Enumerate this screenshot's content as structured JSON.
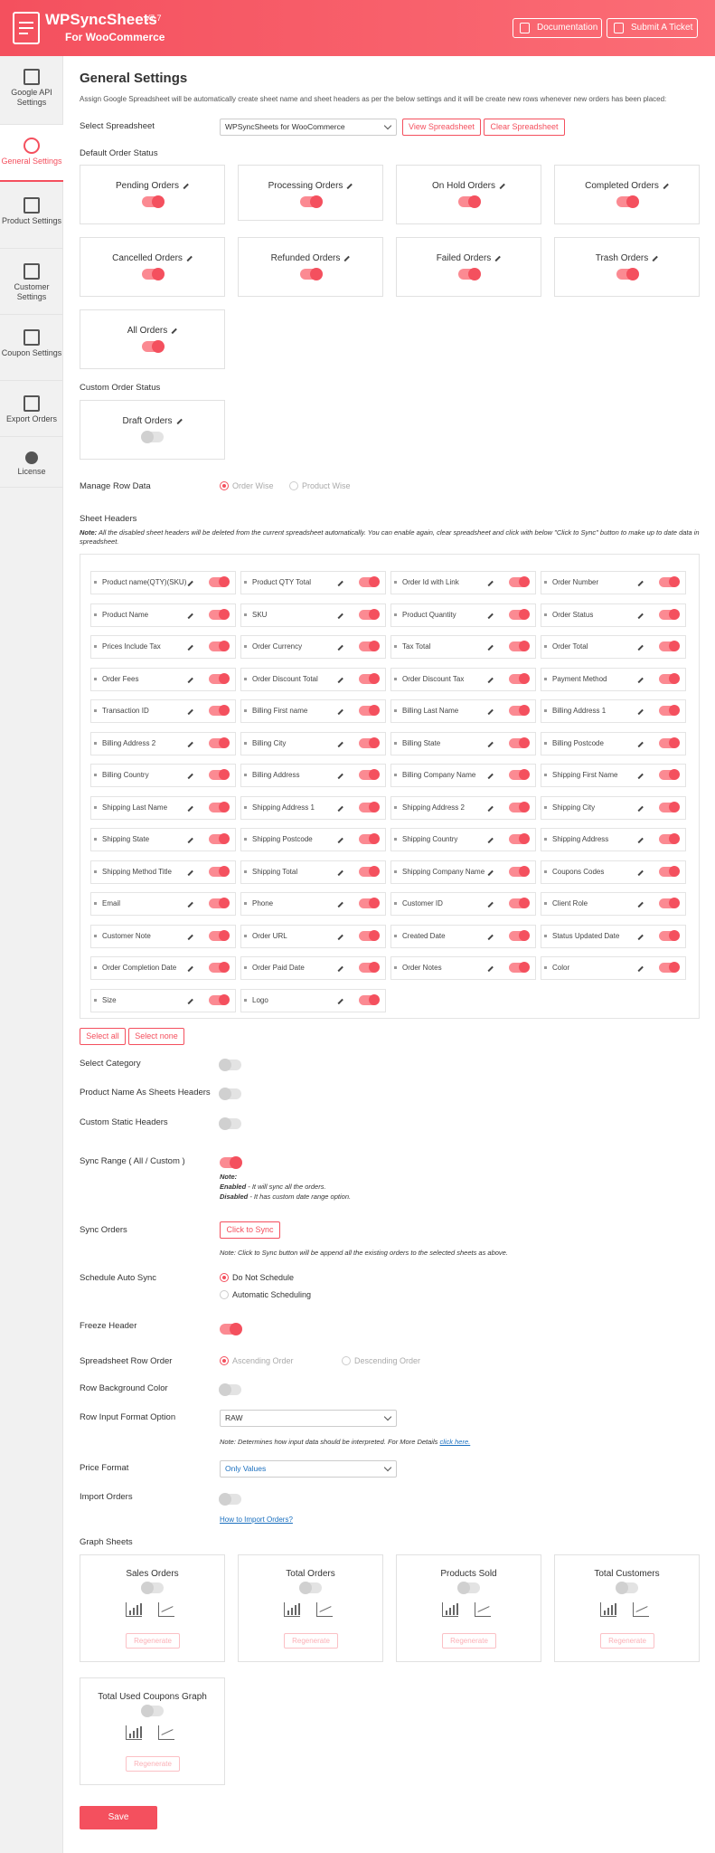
{
  "header": {
    "brand": "WPSyncSheets",
    "brand_sub": "For WooCommerce",
    "version": "V7.7",
    "documentation": "Documentation",
    "submit_ticket": "Submit A Ticket"
  },
  "sidebar": [
    {
      "label": "Google API Settings"
    },
    {
      "label": "General Settings"
    },
    {
      "label": "Product Settings"
    },
    {
      "label": "Customer Settings"
    },
    {
      "label": "Coupon Settings"
    },
    {
      "label": "Export Orders"
    },
    {
      "label": "License"
    }
  ],
  "page": {
    "title": "General Settings",
    "description": "Assign Google Spreadsheet will be automatically create sheet name and sheet headers as per the below settings and it will be create new rows whenever new orders has been placed:"
  },
  "spreadsheet": {
    "label": "Select Spreadsheet",
    "value": "WPSyncSheets for WooCommerce",
    "view": "View Spreadsheet",
    "clear": "Clear Spreadsheet"
  },
  "default_status": {
    "label": "Default Order Status",
    "items": [
      {
        "name": "Pending Orders",
        "on": true
      },
      {
        "name": "Processing Orders",
        "on": true
      },
      {
        "name": "On Hold Orders",
        "on": true
      },
      {
        "name": "Completed Orders",
        "on": true
      },
      {
        "name": "Cancelled Orders",
        "on": true
      },
      {
        "name": "Refunded Orders",
        "on": true
      },
      {
        "name": "Failed Orders",
        "on": true
      },
      {
        "name": "Trash Orders",
        "on": true
      },
      {
        "name": "All Orders",
        "on": true
      }
    ]
  },
  "custom_status": {
    "label": "Custom Order Status",
    "items": [
      {
        "name": "Draft Orders",
        "on": false
      }
    ]
  },
  "manage_row": {
    "label": "Manage Row Data",
    "opt1": "Order Wise",
    "opt2": "Product Wise"
  },
  "sheet_headers": {
    "label": "Sheet Headers",
    "note_b": "Note:",
    "note": " All the disabled sheet headers will be deleted from the current spreadsheet automatically. You can enable again, clear spreadsheet and click with below \"Click to Sync\" button to make up to date data in spreadsheet.",
    "items": [
      "Product name(QTY)(SKU)",
      "Product QTY Total",
      "Order Id with Link",
      "Order Number",
      "Product Name",
      "SKU",
      "Product Quantity",
      "Order Status",
      "Prices Include Tax",
      "Order Currency",
      "Tax Total",
      "Order Total",
      "Order Fees",
      "Order Discount Total",
      "Order Discount Tax",
      "Payment Method",
      "Transaction ID",
      "Billing First name",
      "Billing Last Name",
      "Billing Address 1",
      "Billing Address 2",
      "Billing City",
      "Billing State",
      "Billing Postcode",
      "Billing Country",
      "Billing Address",
      "Billing Company Name",
      "Shipping First Name",
      "Shipping Last Name",
      "Shipping Address 1",
      "Shipping Address 2",
      "Shipping City",
      "Shipping State",
      "Shipping Postcode",
      "Shipping Country",
      "Shipping Address",
      "Shipping Method Title",
      "Shipping Total",
      "Shipping Company Name",
      "Coupons Codes",
      "Email",
      "Phone",
      "Customer ID",
      "Client Role",
      "Customer Note",
      "Order URL",
      "Created Date",
      "Status Updated Date",
      "Order Completion Date",
      "Order Paid Date",
      "Order Notes",
      "Color",
      "Size",
      "Logo"
    ],
    "select_all": "Select all",
    "select_none": "Select none"
  },
  "settings": {
    "select_category": "Select Category",
    "product_name_headers": "Product Name As Sheets Headers",
    "custom_static": "Custom Static Headers",
    "sync_range": "Sync Range ( All / Custom )",
    "sync_note": "Note:",
    "enabled_b": "Enabled",
    "enabled": " - It will sync all the orders.",
    "disabled_b": "Disabled",
    "disabled": " - It has custom date range option.",
    "sync_orders": "Sync Orders",
    "click_sync": "Click to Sync",
    "sync_orders_note": "Note: Click to Sync button will be append all the existing orders to the selected sheets as above.",
    "schedule": "Schedule Auto Sync",
    "sched1": "Do Not Schedule",
    "sched2": "Automatic Scheduling",
    "freeze": "Freeze Header",
    "row_order": "Spreadsheet Row Order",
    "asc": "Ascending Order",
    "desc": "Descending Order",
    "row_bg": "Row Background Color",
    "input_format": "Row Input Format Option",
    "input_value": "RAW",
    "input_note": "Note: Determines how input data should be interpreted. For More Details ",
    "click_here": "click here.",
    "price_format": "Price Format",
    "price_value": "Only Values",
    "import": "Import Orders",
    "how_import": "How to Import Orders?"
  },
  "graphs": {
    "label": "Graph Sheets",
    "regenerate": "Regenerate",
    "items": [
      "Sales Orders",
      "Total Orders",
      "Products Sold",
      "Total Customers",
      "Total Used Coupons Graph"
    ]
  },
  "save": "Save",
  "colors": {
    "accent": "#f4505e"
  }
}
